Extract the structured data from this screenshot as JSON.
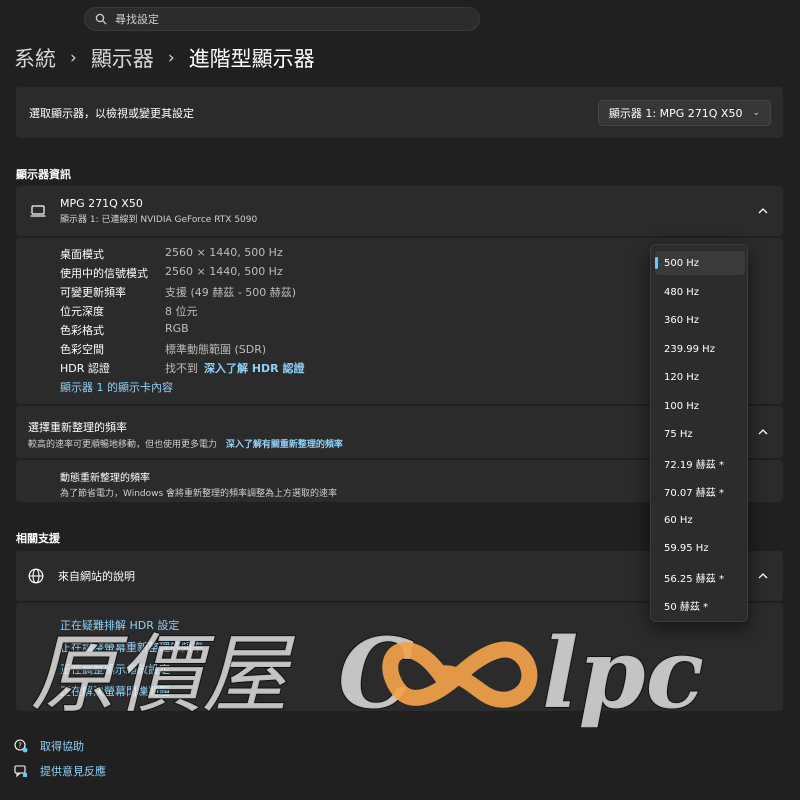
{
  "search": {
    "placeholder": "尋找設定"
  },
  "breadcrumb": {
    "items": [
      "系統",
      "顯示器",
      "進階型顯示器"
    ]
  },
  "select_display": {
    "label": "選取顯示器，以檢視或變更其設定",
    "value": "顯示器 1: MPG 271Q X50"
  },
  "display_info": {
    "heading": "顯示器資訊",
    "monitor_name": "MPG 271Q X50",
    "monitor_sub": "顯示器 1: 已連線到 NVIDIA GeForce RTX 5090",
    "rows": [
      {
        "key": "桌面模式",
        "value": "2560 × 1440, 500 Hz"
      },
      {
        "key": "使用中的信號模式",
        "value": "2560 × 1440, 500 Hz"
      },
      {
        "key": "可變更新頻率",
        "value": "支援 (49 赫茲 - 500 赫茲)"
      },
      {
        "key": "位元深度",
        "value": "8 位元"
      },
      {
        "key": "色彩格式",
        "value": "RGB"
      },
      {
        "key": "色彩空間",
        "value": "標準動態範圍 (SDR)"
      },
      {
        "key": "HDR 認證",
        "value": "找不到",
        "link": "深入了解 HDR 認證"
      }
    ],
    "adapter_link": "顯示器 1 的顯示卡內容"
  },
  "refresh_rate": {
    "title": "選擇重新整理的頻率",
    "desc": "較高的速率可更順暢地移動，但也使用更多電力",
    "link": "深入了解有關重新整理的頻率"
  },
  "dynamic_refresh": {
    "title": "動態重新整理的頻率",
    "desc": "為了節省電力，Windows 會將重新整理的頻率調整為上方選取的速率"
  },
  "related_support": {
    "heading": "相關支援",
    "card_label": "來自網站的說明",
    "links": [
      "正在疑難排解 HDR 設定",
      "正在調整螢幕重新整理的頻率",
      "正在調整顯示縮放設定",
      "正在解決螢幕閃爍問題"
    ]
  },
  "footer": {
    "get_help": "取得協助",
    "feedback": "提供意見反應"
  },
  "flyout": {
    "selected_index": 0,
    "options": [
      "500 Hz",
      "480 Hz",
      "360 Hz",
      "239.99 Hz",
      "120 Hz",
      "100 Hz",
      "75 Hz",
      "72.19 赫茲 *",
      "70.07 赫茲 *",
      "60 Hz",
      "59.95 Hz",
      "56.25 赫茲 *",
      "50 赫茲 *"
    ]
  },
  "watermark": {
    "text": "原價屋",
    "brand": "lpc"
  },
  "colors": {
    "accent": "#60cdff",
    "link": "#8fd0f7",
    "background": "#202020",
    "card": "#2b2b2b",
    "watermark": "#f2a24a"
  }
}
